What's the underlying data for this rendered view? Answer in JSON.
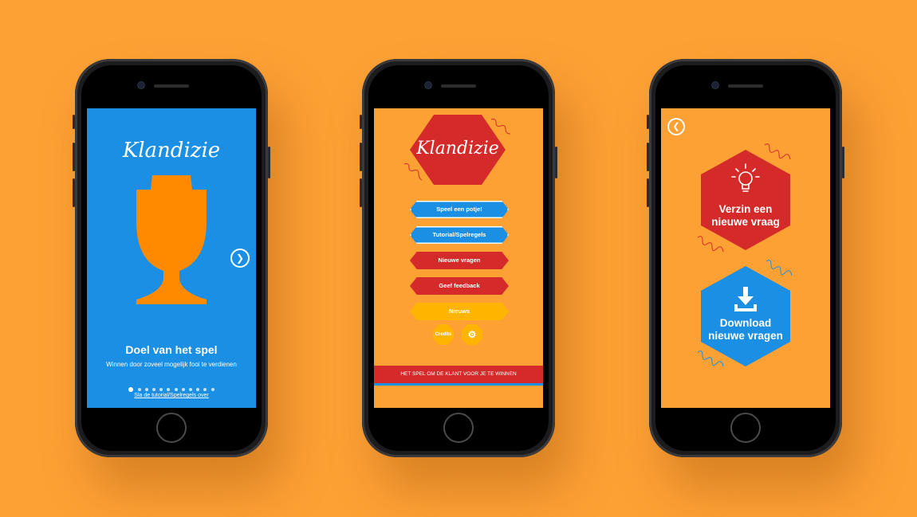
{
  "app_name": "Klandizie",
  "screen1": {
    "title": "Doel van het spel",
    "subtitle": "Winnen door zoveel mogelijk fooi te verdienen",
    "skip_link": "Sla de tutorial/Spelregels over",
    "next_icon": "chevron-right-icon",
    "dots_total": 12,
    "dots_active": 1
  },
  "screen2": {
    "menu": {
      "play": "Speel een potje!",
      "tutorial": "Tutorial/Spelregels",
      "new_questions": "Nieuwe vragen",
      "feedback": "Geef feedback",
      "news": "Nieuws",
      "credits": "Credits",
      "settings_icon": "gear-icon"
    },
    "banner": "HET SPEL OM DE KLANT VOOR JE TE WINNEN"
  },
  "screen3": {
    "back_icon": "chevron-left-icon",
    "create_question": "Verzin een nieuwe vraag",
    "download_questions": "Download nieuwe vragen"
  },
  "colors": {
    "background": "#FDA135",
    "blue": "#1A8FE3",
    "red": "#D42A2A",
    "yellow": "#FFB400",
    "cup_orange": "#FF8A00"
  }
}
